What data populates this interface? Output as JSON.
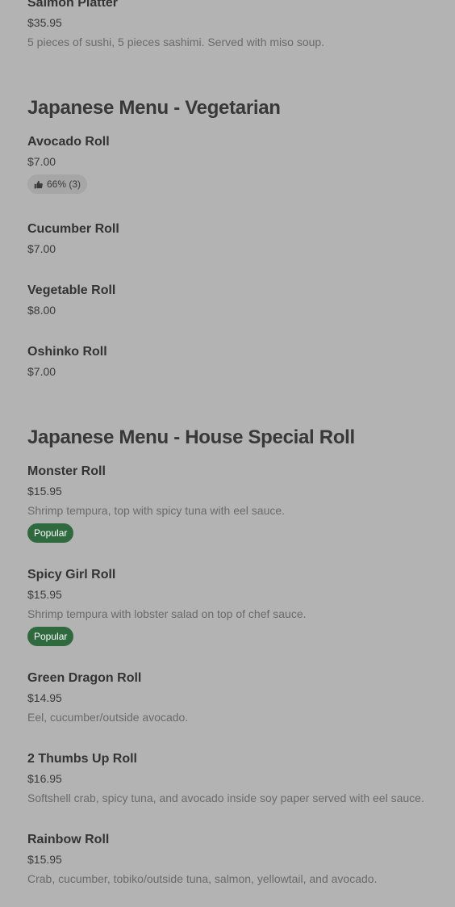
{
  "sections": {
    "previous": {
      "items": [
        {
          "name": "Salmon Platter",
          "price": "$35.95",
          "description": "5 pieces of sushi, 5 pieces sashimi. Served with miso soup."
        }
      ]
    },
    "vegetarian": {
      "title": "Japanese Menu - Vegetarian",
      "items": [
        {
          "name": "Avocado Roll",
          "price": "$7.00",
          "rating": "66% (3)"
        },
        {
          "name": "Cucumber Roll",
          "price": "$7.00"
        },
        {
          "name": "Vegetable Roll",
          "price": "$8.00"
        },
        {
          "name": "Oshinko Roll",
          "price": "$7.00"
        }
      ]
    },
    "house_special": {
      "title": "Japanese Menu - House Special Roll",
      "items": [
        {
          "name": "Monster Roll",
          "price": "$15.95",
          "description": "Shrimp tempura, top with spicy tuna with eel sauce.",
          "badge": "Popular"
        },
        {
          "name": "Spicy Girl Roll",
          "price": "$15.95",
          "description": "Shrimp tempura with lobster salad on top of chef sauce.",
          "badge": "Popular"
        },
        {
          "name": "Green Dragon Roll",
          "price": "$14.95",
          "description": "Eel, cucumber/outside avocado."
        },
        {
          "name": "2 Thumbs Up Roll",
          "price": "$16.95",
          "description": "Softshell crab, spicy tuna, and avocado inside soy paper served with eel sauce."
        },
        {
          "name": "Rainbow Roll",
          "price": "$15.95",
          "description": "Crab, cucumber, tobiko/outside tuna, salmon, yellowtail, and avocado."
        }
      ]
    }
  },
  "icons": {
    "rating_icon": "thumbs-up-icon"
  },
  "colors": {
    "background": "#b3b3b3",
    "popular_badge": "#2f6a3f",
    "rating_badge": "#a6a6a6"
  }
}
